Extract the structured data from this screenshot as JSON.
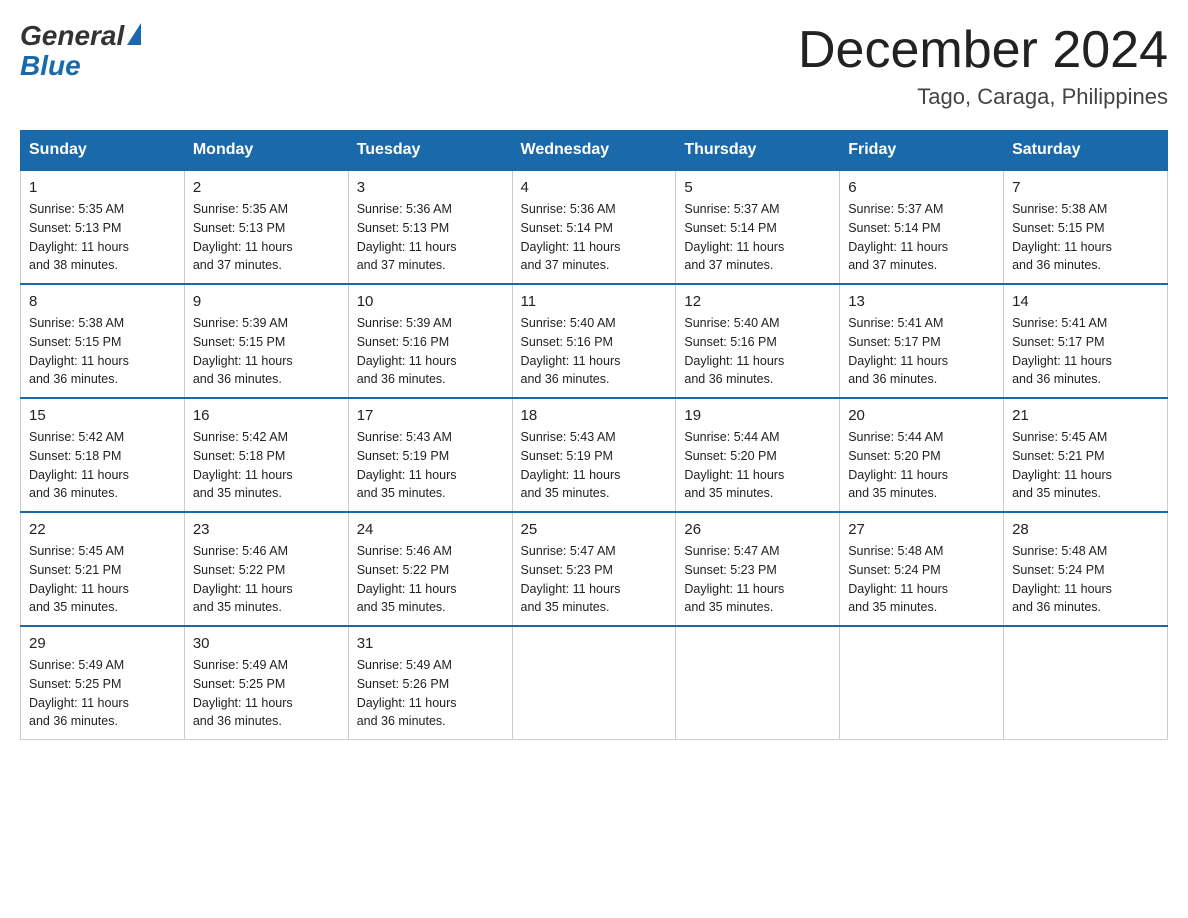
{
  "logo": {
    "general": "General",
    "blue": "Blue"
  },
  "title": {
    "month_year": "December 2024",
    "location": "Tago, Caraga, Philippines"
  },
  "header": {
    "days": [
      "Sunday",
      "Monday",
      "Tuesday",
      "Wednesday",
      "Thursday",
      "Friday",
      "Saturday"
    ]
  },
  "weeks": [
    [
      {
        "day": "1",
        "sunrise": "5:35 AM",
        "sunset": "5:13 PM",
        "daylight": "11 hours and 38 minutes."
      },
      {
        "day": "2",
        "sunrise": "5:35 AM",
        "sunset": "5:13 PM",
        "daylight": "11 hours and 37 minutes."
      },
      {
        "day": "3",
        "sunrise": "5:36 AM",
        "sunset": "5:13 PM",
        "daylight": "11 hours and 37 minutes."
      },
      {
        "day": "4",
        "sunrise": "5:36 AM",
        "sunset": "5:14 PM",
        "daylight": "11 hours and 37 minutes."
      },
      {
        "day": "5",
        "sunrise": "5:37 AM",
        "sunset": "5:14 PM",
        "daylight": "11 hours and 37 minutes."
      },
      {
        "day": "6",
        "sunrise": "5:37 AM",
        "sunset": "5:14 PM",
        "daylight": "11 hours and 37 minutes."
      },
      {
        "day": "7",
        "sunrise": "5:38 AM",
        "sunset": "5:15 PM",
        "daylight": "11 hours and 36 minutes."
      }
    ],
    [
      {
        "day": "8",
        "sunrise": "5:38 AM",
        "sunset": "5:15 PM",
        "daylight": "11 hours and 36 minutes."
      },
      {
        "day": "9",
        "sunrise": "5:39 AM",
        "sunset": "5:15 PM",
        "daylight": "11 hours and 36 minutes."
      },
      {
        "day": "10",
        "sunrise": "5:39 AM",
        "sunset": "5:16 PM",
        "daylight": "11 hours and 36 minutes."
      },
      {
        "day": "11",
        "sunrise": "5:40 AM",
        "sunset": "5:16 PM",
        "daylight": "11 hours and 36 minutes."
      },
      {
        "day": "12",
        "sunrise": "5:40 AM",
        "sunset": "5:16 PM",
        "daylight": "11 hours and 36 minutes."
      },
      {
        "day": "13",
        "sunrise": "5:41 AM",
        "sunset": "5:17 PM",
        "daylight": "11 hours and 36 minutes."
      },
      {
        "day": "14",
        "sunrise": "5:41 AM",
        "sunset": "5:17 PM",
        "daylight": "11 hours and 36 minutes."
      }
    ],
    [
      {
        "day": "15",
        "sunrise": "5:42 AM",
        "sunset": "5:18 PM",
        "daylight": "11 hours and 36 minutes."
      },
      {
        "day": "16",
        "sunrise": "5:42 AM",
        "sunset": "5:18 PM",
        "daylight": "11 hours and 35 minutes."
      },
      {
        "day": "17",
        "sunrise": "5:43 AM",
        "sunset": "5:19 PM",
        "daylight": "11 hours and 35 minutes."
      },
      {
        "day": "18",
        "sunrise": "5:43 AM",
        "sunset": "5:19 PM",
        "daylight": "11 hours and 35 minutes."
      },
      {
        "day": "19",
        "sunrise": "5:44 AM",
        "sunset": "5:20 PM",
        "daylight": "11 hours and 35 minutes."
      },
      {
        "day": "20",
        "sunrise": "5:44 AM",
        "sunset": "5:20 PM",
        "daylight": "11 hours and 35 minutes."
      },
      {
        "day": "21",
        "sunrise": "5:45 AM",
        "sunset": "5:21 PM",
        "daylight": "11 hours and 35 minutes."
      }
    ],
    [
      {
        "day": "22",
        "sunrise": "5:45 AM",
        "sunset": "5:21 PM",
        "daylight": "11 hours and 35 minutes."
      },
      {
        "day": "23",
        "sunrise": "5:46 AM",
        "sunset": "5:22 PM",
        "daylight": "11 hours and 35 minutes."
      },
      {
        "day": "24",
        "sunrise": "5:46 AM",
        "sunset": "5:22 PM",
        "daylight": "11 hours and 35 minutes."
      },
      {
        "day": "25",
        "sunrise": "5:47 AM",
        "sunset": "5:23 PM",
        "daylight": "11 hours and 35 minutes."
      },
      {
        "day": "26",
        "sunrise": "5:47 AM",
        "sunset": "5:23 PM",
        "daylight": "11 hours and 35 minutes."
      },
      {
        "day": "27",
        "sunrise": "5:48 AM",
        "sunset": "5:24 PM",
        "daylight": "11 hours and 35 minutes."
      },
      {
        "day": "28",
        "sunrise": "5:48 AM",
        "sunset": "5:24 PM",
        "daylight": "11 hours and 36 minutes."
      }
    ],
    [
      {
        "day": "29",
        "sunrise": "5:49 AM",
        "sunset": "5:25 PM",
        "daylight": "11 hours and 36 minutes."
      },
      {
        "day": "30",
        "sunrise": "5:49 AM",
        "sunset": "5:25 PM",
        "daylight": "11 hours and 36 minutes."
      },
      {
        "day": "31",
        "sunrise": "5:49 AM",
        "sunset": "5:26 PM",
        "daylight": "11 hours and 36 minutes."
      },
      null,
      null,
      null,
      null
    ]
  ],
  "labels": {
    "sunrise": "Sunrise:",
    "sunset": "Sunset:",
    "daylight": "Daylight:"
  }
}
